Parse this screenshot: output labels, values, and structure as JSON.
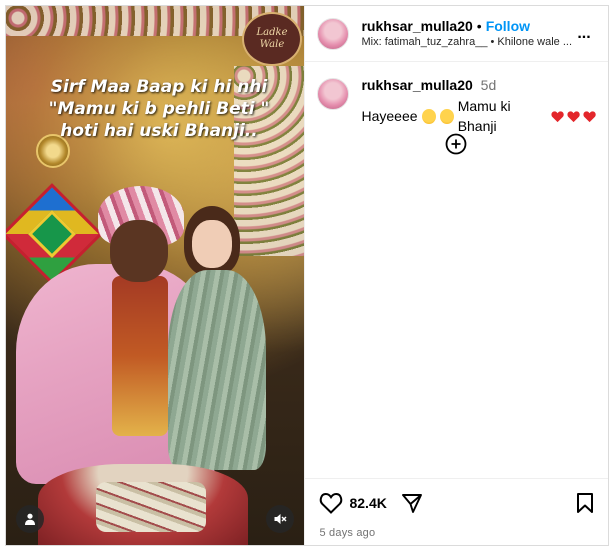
{
  "post": {
    "overlay_lines": [
      "Sirf Maa Baap ki hi nhi",
      "\"Mamu ki b pehli Beti \"",
      "hoti hai uski Bhanji.."
    ],
    "sign_text": "Ladke Wale"
  },
  "header": {
    "username": "rukhsar_mulla20",
    "separator": "•",
    "follow_label": "Follow",
    "audio_text": "Mix: fatimah_tuz_zahra__ • Khilone wale ...",
    "more_label": "..."
  },
  "comment": {
    "username": "rukhsar_mulla20",
    "time": "5d",
    "text_start": "Hayeeee",
    "text_middle": "Mamu ki Bhanji"
  },
  "footer": {
    "likes": "82.4K",
    "posted": "5 days ago"
  },
  "colors": {
    "accent": "#0095f6",
    "heart": "#e3262b"
  },
  "icons": [
    "heart-outline-icon",
    "share-icon",
    "bookmark-icon",
    "user-tag-icon",
    "mute-icon",
    "add-circle-icon"
  ]
}
